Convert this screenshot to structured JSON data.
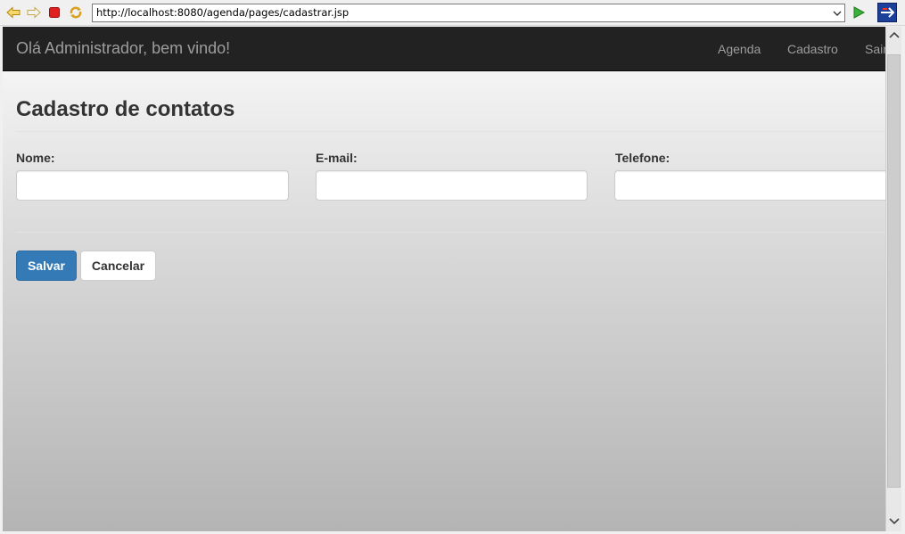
{
  "browser": {
    "url": "http://localhost:8080/agenda/pages/cadastrar.jsp",
    "icons": {
      "back": "back-arrow-icon",
      "forward": "forward-arrow-icon",
      "stop": "stop-icon",
      "refresh": "refresh-icon",
      "go": "go-arrow-icon",
      "extension": "extension-icon"
    }
  },
  "navbar": {
    "brand": "Olá Administrador, bem vindo!",
    "links": [
      "Agenda",
      "Cadastro",
      "Sair"
    ]
  },
  "page": {
    "title": "Cadastro de contatos",
    "fields": [
      {
        "label": "Nome:",
        "value": ""
      },
      {
        "label": "E-mail:",
        "value": ""
      },
      {
        "label": "Telefone:",
        "value": ""
      }
    ],
    "buttons": {
      "save": "Salvar",
      "cancel": "Cancelar"
    }
  },
  "colors": {
    "navbar_bg": "#222222",
    "navbar_text": "#9d9d9d",
    "primary": "#337ab7"
  }
}
